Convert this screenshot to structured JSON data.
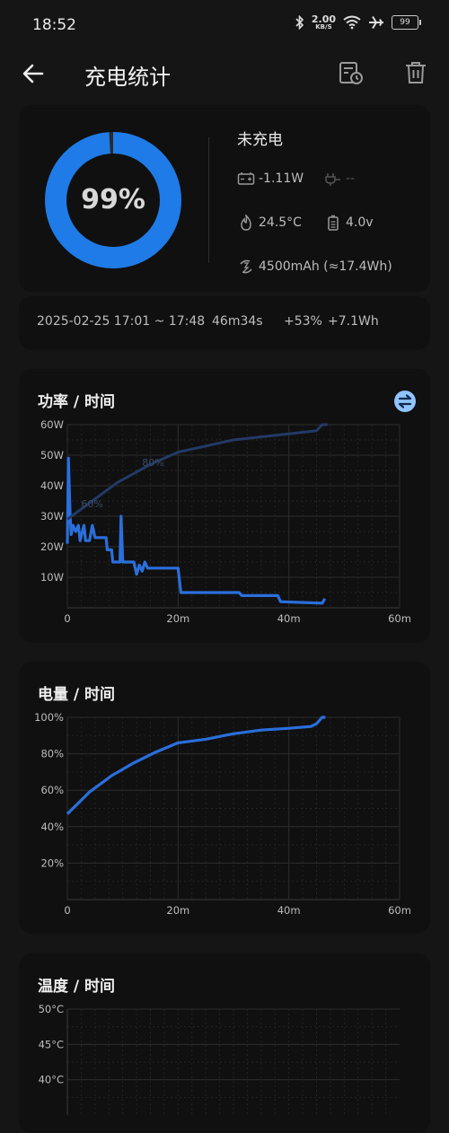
{
  "status_bar": {
    "time": "18:52",
    "net_speed": "2.00",
    "net_unit": "KB/S",
    "battery": "99"
  },
  "header": {
    "title": "充电统计"
  },
  "summary": {
    "percent": 99,
    "percent_label": "99%",
    "state": "未充电",
    "power": "-1.11W",
    "plug": "--",
    "temperature": "24.5°C",
    "voltage": "4.0v",
    "capacity": "4500mAh (≈17.4Wh)",
    "ring_color": "#1e7be8"
  },
  "session": {
    "range": "2025-02-25  17:01 ~ 17:48",
    "duration": "46m34s",
    "delta_pct": "+53%",
    "energy": "+7.1Wh"
  },
  "charts": {
    "power": {
      "title": "功率 / 时间"
    },
    "level": {
      "title": "电量 / 时间"
    },
    "temperature": {
      "title": "温度 / 时间"
    }
  },
  "chart_data": [
    {
      "type": "line",
      "title": "功率 / 时间",
      "x_unit": "minutes",
      "xticks": [
        "0",
        "20m",
        "40m",
        "60m"
      ],
      "xlim": [
        0,
        60
      ],
      "yticks": [
        "10W",
        "20W",
        "30W",
        "40W",
        "50W",
        "60W"
      ],
      "ylim": [
        0,
        60
      ],
      "series": [
        {
          "name": "power",
          "color": "#2a6fdc",
          "points": [
            [
              0,
              21
            ],
            [
              0.2,
              49
            ],
            [
              0.5,
              30
            ],
            [
              0.7,
              24
            ],
            [
              1,
              27
            ],
            [
              1.5,
              25
            ],
            [
              2,
              27
            ],
            [
              2.3,
              22
            ],
            [
              3,
              27
            ],
            [
              3.3,
              22
            ],
            [
              4,
              22
            ],
            [
              4.5,
              27
            ],
            [
              5,
              23
            ],
            [
              7,
              23
            ],
            [
              7.2,
              19
            ],
            [
              8,
              19
            ],
            [
              8.2,
              15
            ],
            [
              9,
              15
            ],
            [
              9.5,
              15
            ],
            [
              9.7,
              30
            ],
            [
              10,
              15
            ],
            [
              12,
              15
            ],
            [
              12.5,
              11
            ],
            [
              13,
              14
            ],
            [
              13.5,
              12
            ],
            [
              14,
              15
            ],
            [
              14.5,
              13
            ],
            [
              20,
              13
            ],
            [
              20.5,
              5
            ],
            [
              31,
              5
            ],
            [
              31.5,
              4
            ],
            [
              38,
              4
            ],
            [
              38.5,
              2
            ],
            [
              46,
              1.5
            ],
            [
              46.5,
              3
            ]
          ]
        },
        {
          "name": "level overlay",
          "color": "#223a66",
          "labels": [
            "60%",
            "80%"
          ],
          "points": [
            [
              0,
              29
            ],
            [
              3,
              33
            ],
            [
              6,
              37
            ],
            [
              9,
              41
            ],
            [
              12,
              44
            ],
            [
              15,
              47
            ],
            [
              20,
              51
            ],
            [
              25,
              53
            ],
            [
              30,
              55
            ],
            [
              35,
              56
            ],
            [
              40,
              57
            ],
            [
              45,
              58
            ],
            [
              46,
              60
            ],
            [
              47,
              60
            ]
          ]
        }
      ],
      "grid": true
    },
    {
      "type": "line",
      "title": "电量 / 时间",
      "x_unit": "minutes",
      "xticks": [
        "0",
        "20m",
        "40m",
        "60m"
      ],
      "xlim": [
        0,
        60
      ],
      "yticks": [
        "20%",
        "40%",
        "60%",
        "80%",
        "100%"
      ],
      "ylim": [
        0,
        100
      ],
      "series": [
        {
          "name": "battery level",
          "color": "#2a6fdc",
          "points": [
            [
              0,
              47
            ],
            [
              4,
              59
            ],
            [
              8,
              68
            ],
            [
              12,
              75
            ],
            [
              16,
              81
            ],
            [
              20,
              86
            ],
            [
              25,
              88
            ],
            [
              30,
              91
            ],
            [
              35,
              93
            ],
            [
              40,
              94
            ],
            [
              44,
              95
            ],
            [
              45,
              96.5
            ],
            [
              46,
              100
            ],
            [
              46.6,
              100
            ]
          ]
        }
      ],
      "grid": true
    },
    {
      "type": "line",
      "title": "温度 / 时间",
      "yticks": [
        "40°C",
        "45°C",
        "50°C"
      ],
      "ylim": [
        40,
        50
      ],
      "series": [],
      "grid": true
    }
  ]
}
